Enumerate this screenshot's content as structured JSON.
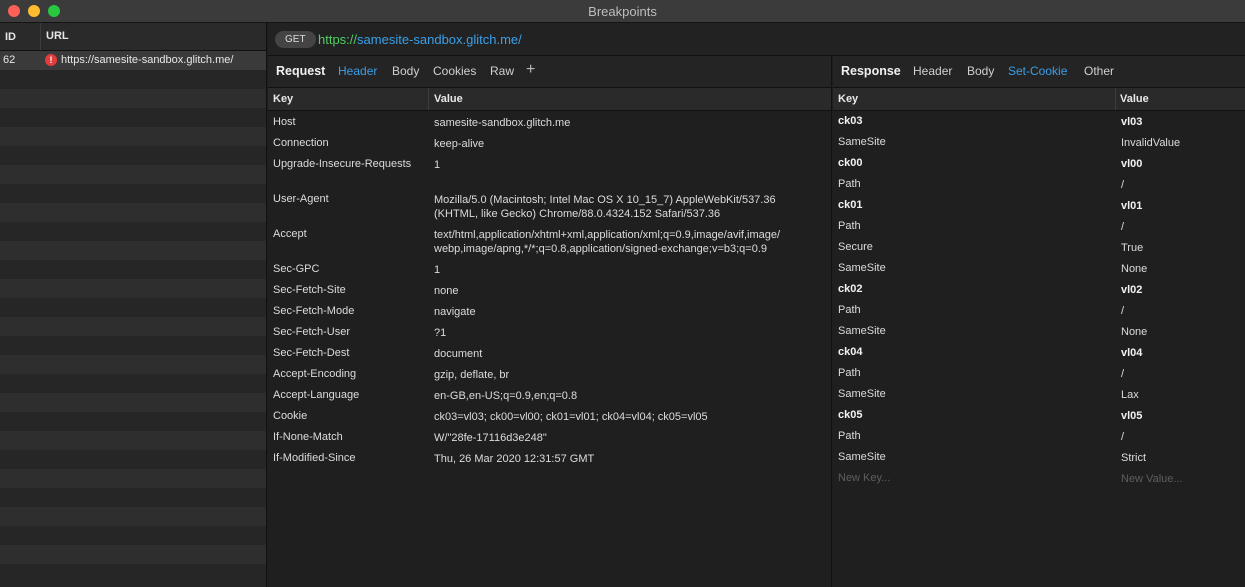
{
  "window": {
    "title": "Breakpoints"
  },
  "left": {
    "col_id": "ID",
    "col_url": "URL",
    "selected": {
      "id": "62",
      "url": "https://samesite-sandbox.glitch.me/"
    }
  },
  "urlbar": {
    "method": "GET",
    "scheme": "https://",
    "host": "samesite-sandbox.glitch.me/"
  },
  "request": {
    "title": "Request",
    "tabs": [
      "Header",
      "Body",
      "Cookies",
      "Raw"
    ],
    "active_tab": "Header",
    "add_icon": "+",
    "key_header": "Key",
    "value_header": "Value",
    "rows": [
      {
        "key": "Host",
        "value": "samesite-sandbox.glitch.me"
      },
      {
        "key": "Connection",
        "value": "keep-alive"
      },
      {
        "key": "Upgrade-Insecure-Requests",
        "value": "1"
      },
      {
        "key": "User-Agent",
        "value": "Mozilla/5.0 (Macintosh; Intel Mac OS X 10_15_7) AppleWebKit/537.36",
        "value2": "(KHTML, like Gecko) Chrome/88.0.4324.152 Safari/537.36"
      },
      {
        "key": "Accept",
        "value": "text/html,application/xhtml+xml,application/xml;q=0.9,image/avif,image/",
        "value2": "webp,image/apng,*/*;q=0.8,application/signed-exchange;v=b3;q=0.9"
      },
      {
        "key": "Sec-GPC",
        "value": "1"
      },
      {
        "key": "Sec-Fetch-Site",
        "value": "none"
      },
      {
        "key": "Sec-Fetch-Mode",
        "value": "navigate"
      },
      {
        "key": "Sec-Fetch-User",
        "value": "?1"
      },
      {
        "key": "Sec-Fetch-Dest",
        "value": "document"
      },
      {
        "key": "Accept-Encoding",
        "value": "gzip, deflate, br"
      },
      {
        "key": "Accept-Language",
        "value": "en-GB,en-US;q=0.9,en;q=0.8"
      },
      {
        "key": "Cookie",
        "value": "ck03=vl03; ck00=vl00; ck01=vl01; ck04=vl04; ck05=vl05"
      },
      {
        "key": "If-None-Match",
        "value": "W/\"28fe-17116d3e248\""
      },
      {
        "key": "If-Modified-Since",
        "value": "Thu, 26 Mar 2020 12:31:57 GMT"
      }
    ]
  },
  "response": {
    "title": "Response",
    "tabs": [
      "Header",
      "Body",
      "Set-Cookie",
      "Other"
    ],
    "active_tab": "Set-Cookie",
    "key_header": "Key",
    "value_header": "Value",
    "rows": [
      {
        "key": "ck03",
        "value": "vl03",
        "bold": true
      },
      {
        "key": "SameSite",
        "value": "InvalidValue"
      },
      {
        "key": "ck00",
        "value": "vl00",
        "bold": true
      },
      {
        "key": "Path",
        "value": "/"
      },
      {
        "key": "ck01",
        "value": "vl01",
        "bold": true
      },
      {
        "key": "Path",
        "value": "/"
      },
      {
        "key": "Secure",
        "value": "True"
      },
      {
        "key": "SameSite",
        "value": "None"
      },
      {
        "key": "ck02",
        "value": "vl02",
        "bold": true
      },
      {
        "key": "Path",
        "value": "/"
      },
      {
        "key": "SameSite",
        "value": "None"
      },
      {
        "key": "ck04",
        "value": "vl04",
        "bold": true
      },
      {
        "key": "Path",
        "value": "/"
      },
      {
        "key": "SameSite",
        "value": "Lax"
      },
      {
        "key": "ck05",
        "value": "vl05",
        "bold": true
      },
      {
        "key": "Path",
        "value": "/"
      },
      {
        "key": "SameSite",
        "value": "Strict"
      }
    ],
    "new_key_placeholder": "New Key...",
    "new_value_placeholder": "New Value..."
  }
}
